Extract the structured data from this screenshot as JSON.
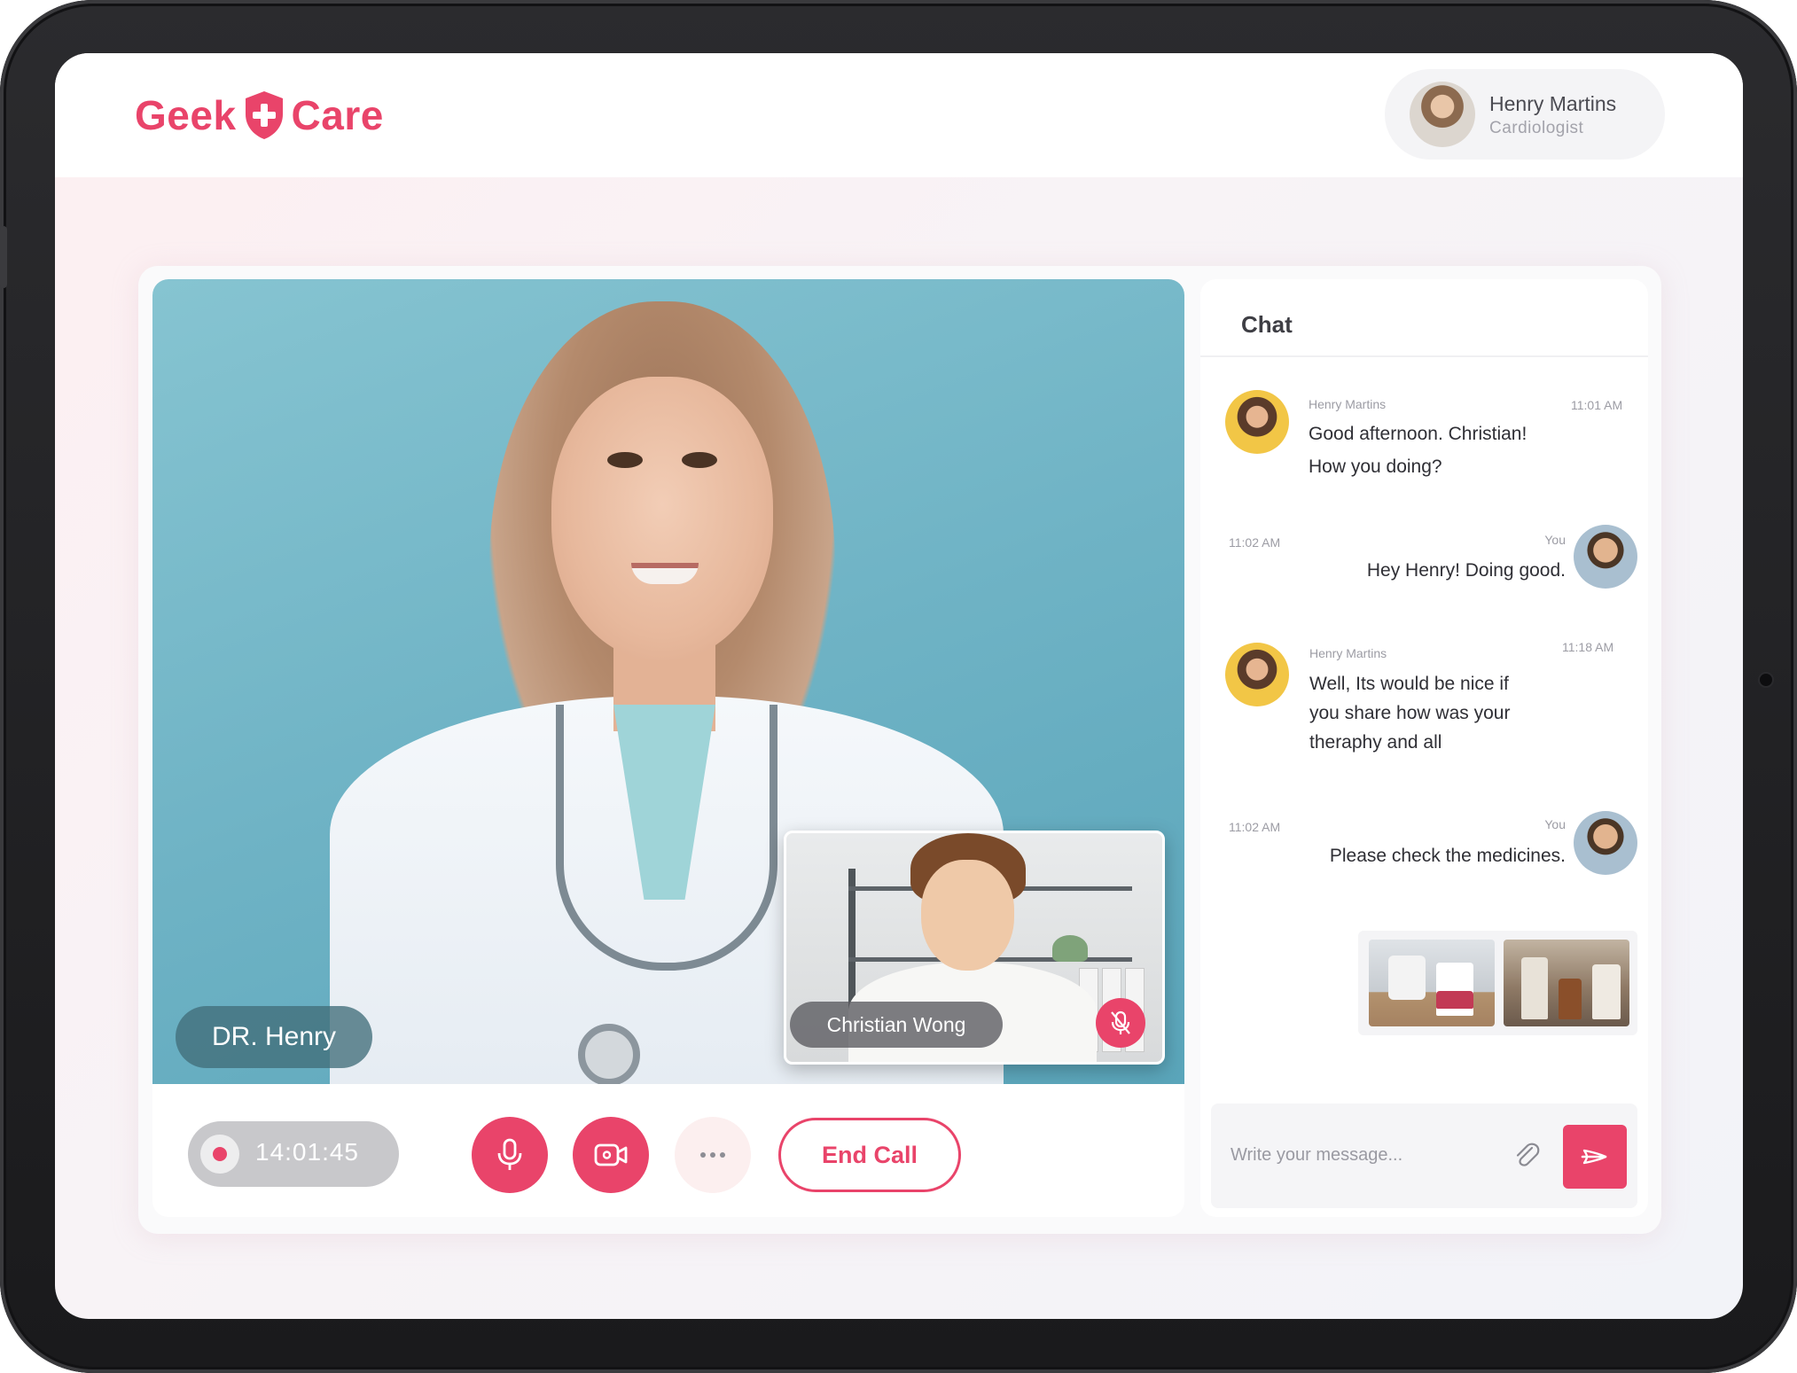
{
  "brand": {
    "name_left": "Geek",
    "name_right": "Care",
    "accent_color": "#e9446a"
  },
  "profile": {
    "name": "Henry Martins",
    "role": "Cardiologist"
  },
  "video": {
    "main_participant": "DR. Henry",
    "pip_participant": "Christian Wong",
    "pip_muted": true
  },
  "controls": {
    "timer": "14:01:45",
    "recording": true,
    "mic_icon": "microphone-icon",
    "camera_icon": "video-camera-icon",
    "more_icon": "more-dots-icon",
    "end_call_label": "End Call"
  },
  "chat": {
    "title": "Chat",
    "messages": [
      {
        "sender": "Henry Martins",
        "time": "11:01 AM",
        "text_lines": [
          "Good afternoon. Christian!",
          "How you doing?"
        ],
        "side": "left"
      },
      {
        "sender": "You",
        "time": "11:02 AM",
        "text_lines": [
          "Hey Henry! Doing good."
        ],
        "side": "right"
      },
      {
        "sender": "Henry Martins",
        "time": "11:18 AM",
        "text_lines": [
          "Well, Its would be nice if",
          "you share how was your",
          "theraphy and all"
        ],
        "side": "left"
      },
      {
        "sender": "You",
        "time": "11:02 AM",
        "text_lines": [
          "Please check the medicines."
        ],
        "side": "right"
      }
    ],
    "attachments_count": 2,
    "input_placeholder": "Write your message...",
    "attach_icon": "paperclip-icon",
    "send_icon": "send-icon"
  }
}
